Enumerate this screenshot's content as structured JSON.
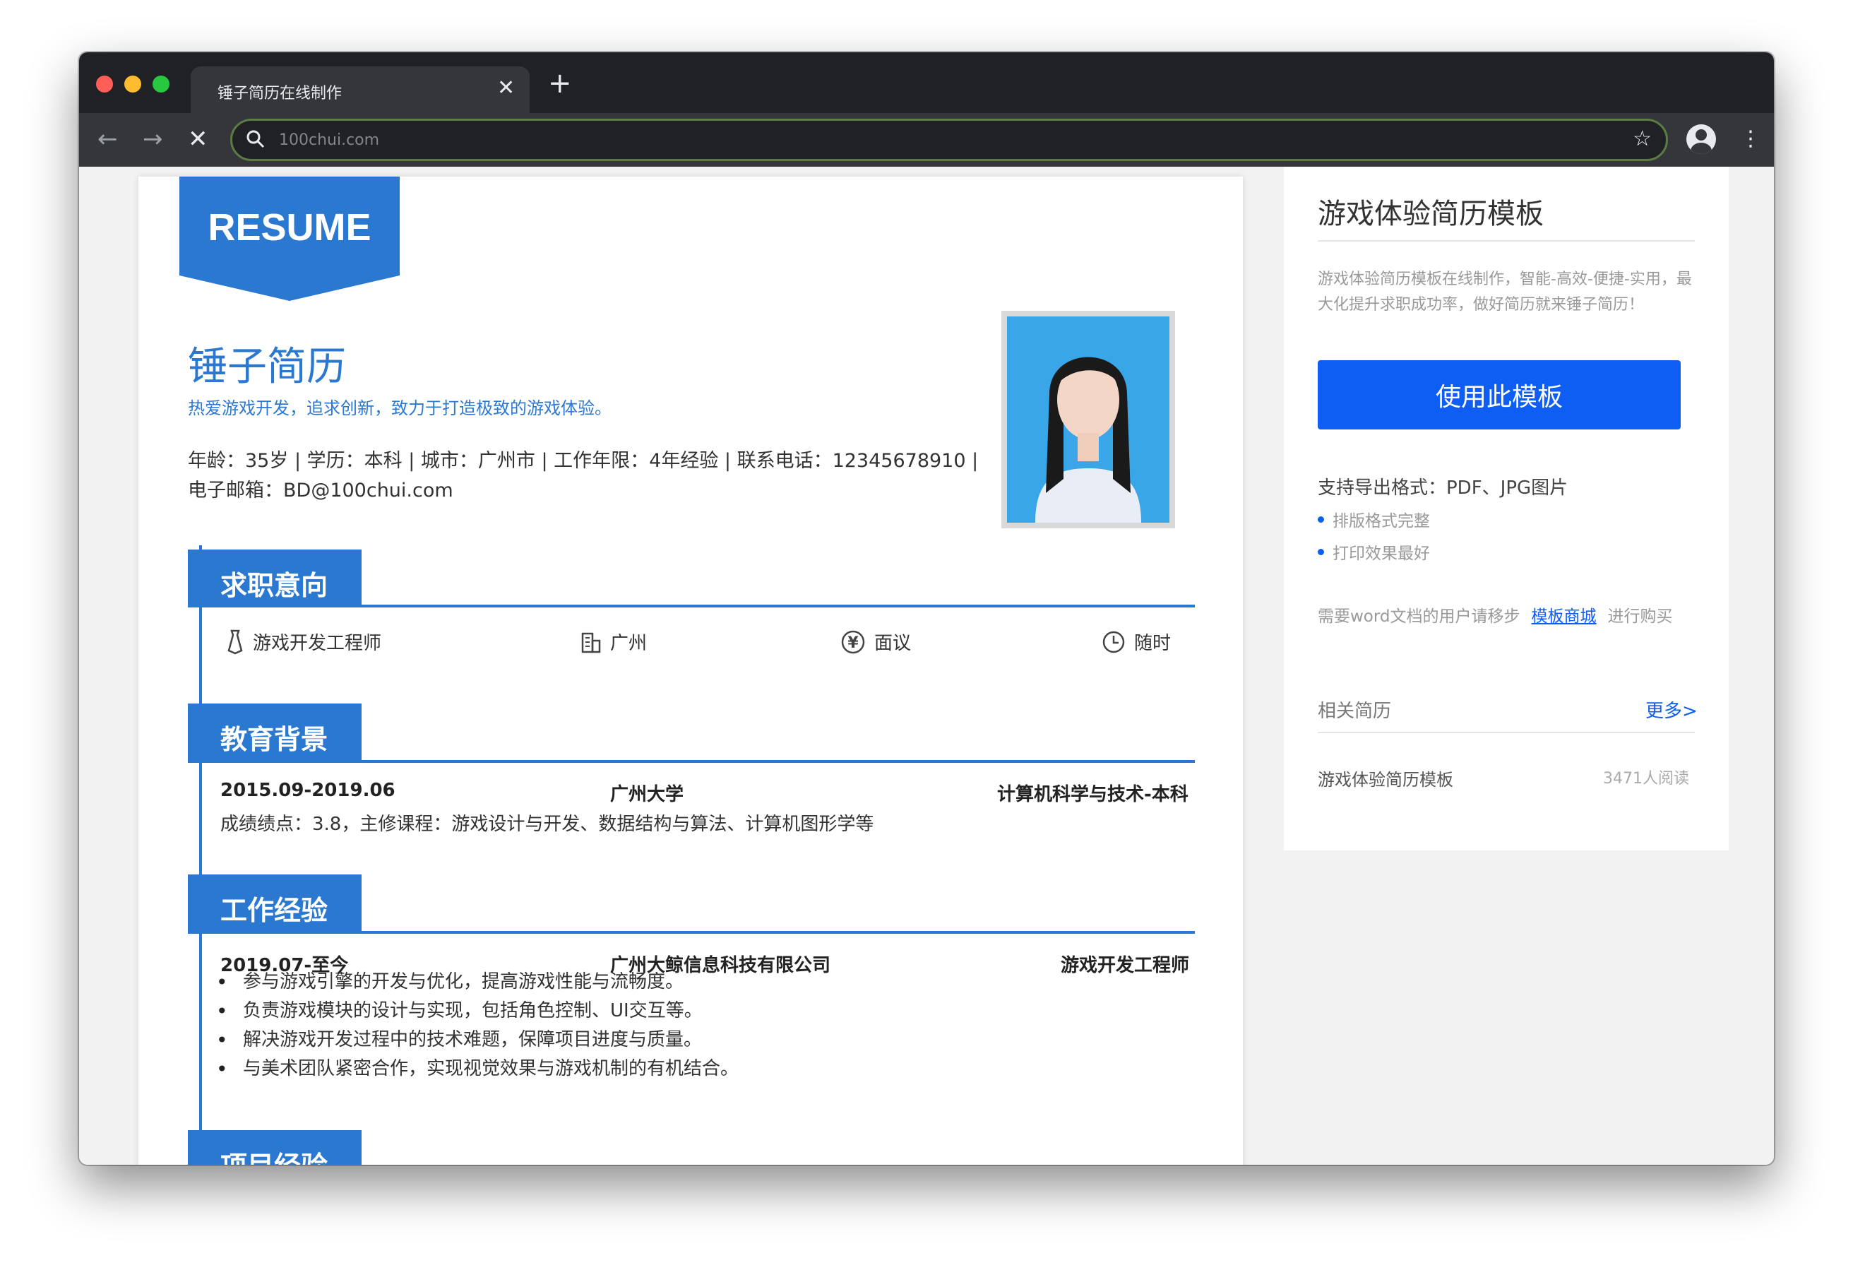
{
  "browser": {
    "tab_title": "锤子简历在线制作",
    "tab_close": "✕",
    "new_tab": "+",
    "url": "100chui.com",
    "back": "←",
    "forward": "→",
    "stop": "✕",
    "star": "☆",
    "menu": "⋮"
  },
  "resume": {
    "badge": "RESUME",
    "name": "锤子简历",
    "slogan": "热爱游戏开发，追求创新，致力于打造极致的游戏体验。",
    "info_line1": "年龄：35岁 | 学历：本科 | 城市：广州市 | 工作年限：4年经验 | 联系电话：12345678910 |",
    "info_line2": "电子邮箱：BD@100chui.com",
    "sections": {
      "intent": "求职意向",
      "education": "教育背景",
      "work": "工作经验",
      "project": "项目经验"
    },
    "intent": {
      "position": "游戏开发工程师",
      "city": "广州",
      "salary": "面议",
      "availability": "随时"
    },
    "education": {
      "period": "2015.09-2019.06",
      "school": "广州大学",
      "major": "计算机科学与技术-本科",
      "detail": "成绩绩点：3.8，主修课程：游戏设计与开发、数据结构与算法、计算机图形学等"
    },
    "work": {
      "period": "2019.07-至今",
      "company": "广州大鲸信息科技有限公司",
      "title": "游戏开发工程师",
      "bullets": [
        "参与游戏引擎的开发与优化，提高游戏性能与流畅度。",
        "负责游戏模块的设计与实现，包括角色控制、UI交互等。",
        "解决游戏开发过程中的技术难题，保障项目进度与质量。",
        "与美术团队紧密合作，实现视觉效果与游戏机制的有机结合。"
      ]
    }
  },
  "sidebar": {
    "title": "游戏体验简历模板",
    "desc": "游戏体验简历模板在线制作，智能-高效-便捷-实用，最大化提升求职成功率，做好简历就来锤子简历！",
    "use_button": "使用此模板",
    "formats": "支持导出格式：PDF、JPG图片",
    "features": [
      "排版格式完整",
      "打印效果最好"
    ],
    "word_prefix": "需要word文档的用户请移步",
    "word_link": "模板商城",
    "word_suffix": "进行购买",
    "related_label": "相关简历",
    "more_link": "更多>",
    "related_items": [
      {
        "title": "游戏体验简历模板",
        "reads": "3471人阅读"
      }
    ]
  },
  "colors": {
    "accent": "#2b78d0",
    "button": "#0e5ef3",
    "chrome_dark": "#202124",
    "chrome_tab": "#35363a"
  }
}
